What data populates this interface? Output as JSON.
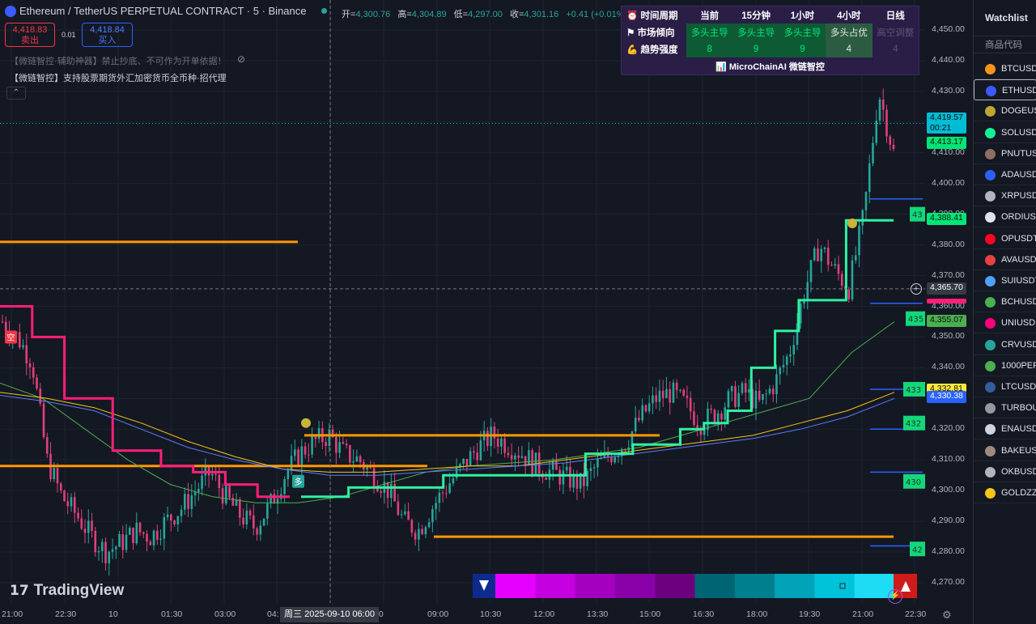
{
  "header": {
    "symbol_title": "Ethereum / TetherUS PERPETUAL CONTRACT · 5 · Binance",
    "ohlc": [
      {
        "k": "开=",
        "v": "4,300.76"
      },
      {
        "k": "高=",
        "v": "4,304.89"
      },
      {
        "k": "低=",
        "v": "4,297.00"
      },
      {
        "k": "收=",
        "v": "4,301.16"
      },
      {
        "k": "",
        "v": "+0.41 (+0.01%)"
      }
    ],
    "sell_price": "4,418.83",
    "sell_label": "卖出",
    "spread": "0.01",
    "buy_price": "4,418.84",
    "buy_label": "买入",
    "note_dim": "【微链智控·辅助神器】禁止抄底、不可作为开单依据！",
    "note": "【微链智控】支持股票期货外汇加密货币全币种·招代理",
    "collapse": "⌃"
  },
  "signal_table": {
    "headers": [
      "时间周期",
      "当前",
      "15分钟",
      "1小时",
      "4小时",
      "日线"
    ],
    "trend_label": "市场倾向",
    "trend": [
      "多头主导",
      "多头主导",
      "多头主导",
      "多头占优",
      "高空调整"
    ],
    "strength_label": "趋势强度",
    "strength": [
      "8",
      "9",
      "9",
      "4",
      "4"
    ],
    "footer": "📊 MicroChainAI 微链智控",
    "icons": [
      "alarm-clock-icon",
      "flag-icon",
      "flexed-arm-icon"
    ]
  },
  "watermark": "TradingView",
  "crosshair_date": "周三 2025-09-10   06:00",
  "chart_data": {
    "type": "candlestick",
    "y_axis": {
      "min": 4265,
      "max": 4455,
      "ticks": [
        4270,
        4280,
        4290,
        4300,
        4310,
        4320,
        4330,
        4340,
        4350,
        4360,
        4370,
        4380,
        4390,
        4400,
        4410,
        4420,
        4430,
        4440,
        4450
      ],
      "tick_labels": [
        "4,270.00",
        "4,280.00",
        "4,290.00",
        "4,300.00",
        "4,310.00",
        "4,320.00",
        "4,330.00",
        "4,340.00",
        "4,350.00",
        "4,360.00",
        "4,370.00",
        "4,380.00",
        "4,390.00",
        "4,400.00",
        "4,410.00",
        "4,420.00",
        "4,430.00",
        "4,440.00",
        "4,450.00"
      ]
    },
    "x_axis_labels": [
      "21:00",
      "22:30",
      "10",
      "01:30",
      "03:00",
      "04:",
      "",
      "30",
      "09:00",
      "10:30",
      "12:00",
      "13:30",
      "15:00",
      "16:30",
      "18:00",
      "19:30",
      "21:00",
      "22:30"
    ],
    "price_path": [
      4355,
      4350,
      4342,
      4310,
      4298,
      4292,
      4285,
      4280,
      4283,
      4287,
      4285,
      4290,
      4294,
      4300,
      4306,
      4298,
      4292,
      4288,
      4295,
      4305,
      4312,
      4316,
      4318,
      4312,
      4310,
      4305,
      4300,
      4290,
      4287,
      4295,
      4302,
      4308,
      4314,
      4318,
      4315,
      4312,
      4308,
      4306,
      4304,
      4302,
      4308,
      4312,
      4316,
      4324,
      4330,
      4332,
      4328,
      4322,
      4325,
      4330,
      4332,
      4328,
      4335,
      4345,
      4365,
      4380,
      4372,
      4366,
      4390,
      4430,
      4410
    ],
    "supertrend_bear": [
      4360,
      4360,
      4350,
      4350,
      4330,
      4330,
      4330,
      4313,
      4313,
      4313,
      4308,
      4308,
      4306,
      4306,
      4302,
      4302,
      4298,
      4298
    ],
    "supertrend_bull": [
      4298,
      4298,
      4301,
      4301,
      4301,
      4301,
      4305,
      4305,
      4305,
      4305,
      4305,
      4305,
      4312,
      4312,
      4315,
      4315,
      4320,
      4322,
      4326,
      4340,
      4352,
      4362,
      4362,
      4388,
      4388
    ],
    "ma_green": [
      4335,
      4330,
      4320,
      4310,
      4302,
      4298,
      4296,
      4296,
      4298,
      4302,
      4306,
      4308,
      4309,
      4310,
      4312,
      4314,
      4318,
      4322,
      4326,
      4330,
      4345,
      4355
    ],
    "ma_yellow": [
      4332,
      4330,
      4327,
      4322,
      4316,
      4311,
      4307,
      4306,
      4306,
      4307,
      4308,
      4308,
      4310,
      4312,
      4314,
      4316,
      4318,
      4322,
      4326,
      4332
    ],
    "ma_blue": [
      4331,
      4329,
      4326,
      4320,
      4314,
      4310,
      4307,
      4305,
      4305,
      4306,
      4307,
      4308,
      4309,
      4311,
      4313,
      4315,
      4317,
      4320,
      4324,
      4330
    ],
    "levels": [
      {
        "name": "resistance-1",
        "value": 4381
      },
      {
        "name": "support-1",
        "value": 4308
      },
      {
        "name": "range-top",
        "value": 4318
      },
      {
        "name": "range-bottom",
        "value": 4285
      }
    ],
    "price_labels": [
      {
        "text": "4,419.57",
        "sub": "00:21",
        "value": 4419.57,
        "color": "#00bcd4"
      },
      {
        "text": "4,413.17",
        "value": 4413.17,
        "color": "#00e676"
      },
      {
        "text": "4,388.41",
        "value": 4388.41,
        "color": "#00e676"
      },
      {
        "text": "4,365.70",
        "value": 4365.7,
        "color": "#363a45"
      },
      {
        "text": "4,355.07",
        "value": 4355.07,
        "color": "#4caf50"
      },
      {
        "text": "4,332.81",
        "value": 4332.81,
        "color": "#ffeb3b"
      },
      {
        "text": "4,330.38",
        "value": 4330.38,
        "color": "#2962ff"
      }
    ],
    "signal_labels": [
      {
        "text": "空",
        "color": "#f23645"
      },
      {
        "text": "多",
        "color": "#26a69a"
      }
    ],
    "right_tags": [
      "43",
      "435",
      "433",
      "432",
      "430",
      "42"
    ]
  },
  "watchlist": {
    "title": "Watchlist",
    "col": "商品代码",
    "items": [
      {
        "sym": "BTCUSD",
        "c": "#f7931a"
      },
      {
        "sym": "ETHUSD",
        "c": "#3d5afe"
      },
      {
        "sym": "DOGEUS",
        "c": "#c2a633"
      },
      {
        "sym": "SOLUSD",
        "c": "#14f195"
      },
      {
        "sym": "PNUTUS",
        "c": "#8d6e63"
      },
      {
        "sym": "ADAUSD",
        "c": "#2962ff"
      },
      {
        "sym": "XRPUSD",
        "c": "#b2b5be"
      },
      {
        "sym": "ORDIUS",
        "c": "#e0e3eb"
      },
      {
        "sym": "OPUSDT",
        "c": "#ff0420"
      },
      {
        "sym": "AVAUSDT",
        "c": "#e84142"
      },
      {
        "sym": "SUIUSDT",
        "c": "#4da2ff"
      },
      {
        "sym": "BCHUSD",
        "c": "#4caf50"
      },
      {
        "sym": "UNIUSD",
        "c": "#ff007a"
      },
      {
        "sym": "CRVUSD",
        "c": "#26a69a"
      },
      {
        "sym": "1000PEP",
        "c": "#4caf50"
      },
      {
        "sym": "LTCUSDT",
        "c": "#345d9d"
      },
      {
        "sym": "TURBOU",
        "c": "#9598a1"
      },
      {
        "sym": "ENAUSD",
        "c": "#d1d4dc"
      },
      {
        "sym": "BAKEUS",
        "c": "#a1887f"
      },
      {
        "sym": "OKBUSD",
        "c": "#b2b5be"
      },
      {
        "sym": "GOLDZZ",
        "c": "#f5c518"
      }
    ]
  },
  "colors": {
    "bull": "#26a69a",
    "bear": "#ef5350",
    "candle_pink": "#e0407a",
    "st_bull": "#2ef2a0",
    "st_bear": "#ff1f7a",
    "level": "#ff9800",
    "grid": "#1f2330"
  }
}
